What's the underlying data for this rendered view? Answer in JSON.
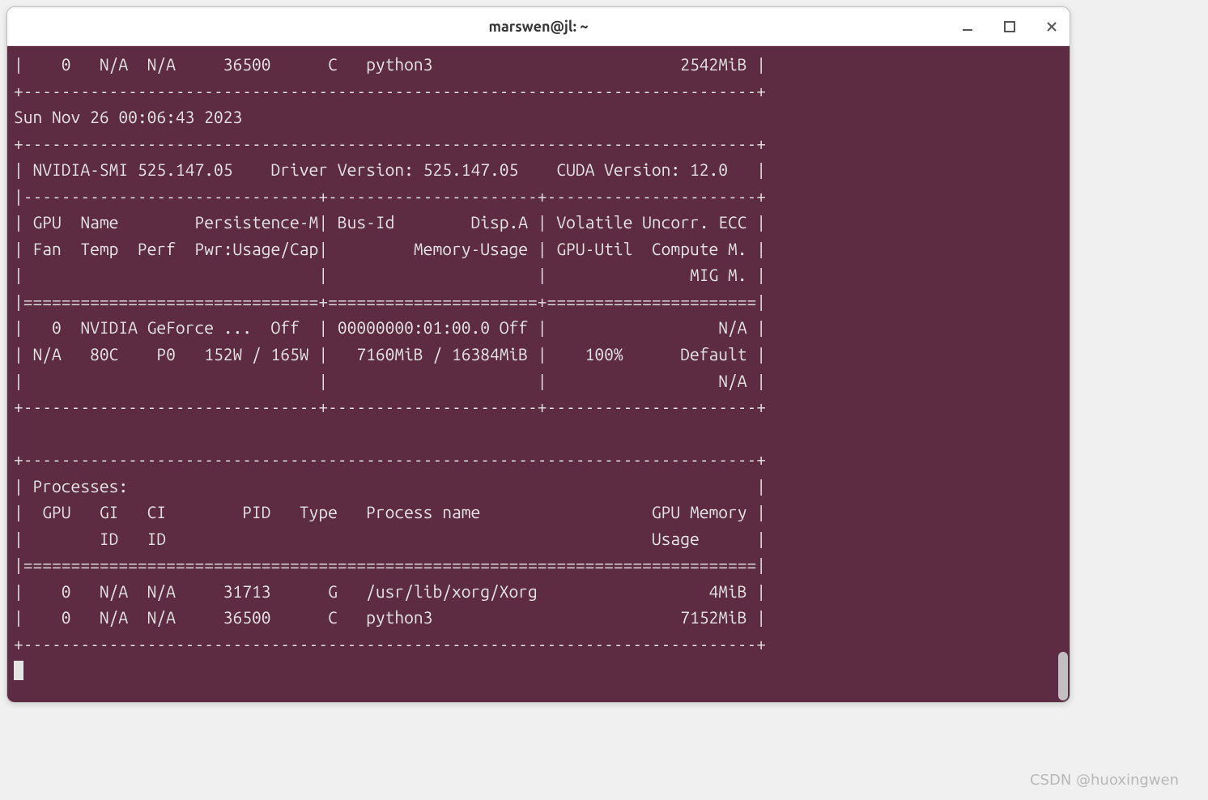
{
  "window": {
    "title": "marswen@jl: ~"
  },
  "watermark": "CSDN @huoxingwen",
  "colors": {
    "terminal_bg": "#5d2b42",
    "terminal_fg": "#e4e4e4"
  },
  "previous_tail": {
    "process": {
      "gpu": "0",
      "gi": "N/A",
      "ci": "N/A",
      "pid": "36500",
      "type": "C",
      "name": "python3",
      "mem": "2542MiB"
    }
  },
  "timestamp": "Sun Nov 26 00:06:43 2023",
  "header": {
    "nvidia_smi": "525.147.05",
    "driver_version": "525.147.05",
    "cuda_version": "12.0"
  },
  "gpu_table": {
    "headers": {
      "c1l1": "GPU  Name        Persistence-M",
      "c1l2": "Fan  Temp  Perf  Pwr:Usage/Cap",
      "c2l1": "Bus-Id        Disp.A",
      "c2l2": "Memory-Usage",
      "c3l1": "Volatile Uncorr. ECC",
      "c3l2": "GPU-Util  Compute M.",
      "c3l3": "MIG M."
    },
    "row": {
      "gpu_id": "0",
      "name": "NVIDIA GeForce ...",
      "persistence_m": "Off",
      "fan": "N/A",
      "temp": "80C",
      "perf": "P0",
      "pwr": "152W / 165W",
      "bus_id": "00000000:01:00.0",
      "disp_a": "Off",
      "memory": "7160MiB / 16384MiB",
      "ecc": "N/A",
      "gpu_util": "100%",
      "compute_m": "Default",
      "mig_m": "N/A"
    }
  },
  "processes": {
    "label": "Processes:",
    "headers": {
      "gpu": "GPU",
      "gi": "GI",
      "ci": "CI",
      "pid": "PID",
      "type": "Type",
      "name": "Process name",
      "mem1": "GPU Memory",
      "id": "ID",
      "mem2": "Usage"
    },
    "rows": [
      {
        "gpu": "0",
        "gi": "N/A",
        "ci": "N/A",
        "pid": "31713",
        "type": "G",
        "name": "/usr/lib/xorg/Xorg",
        "mem": "4MiB"
      },
      {
        "gpu": "0",
        "gi": "N/A",
        "ci": "N/A",
        "pid": "36500",
        "type": "C",
        "name": "python3",
        "mem": "7152MiB"
      }
    ]
  },
  "lines": {
    "l01": "|    0   N/A  N/A     36500      C   python3                          2542MiB |",
    "l02": "+-----------------------------------------------------------------------------+",
    "l03": "Sun Nov 26 00:06:43 2023",
    "l04": "+-----------------------------------------------------------------------------+",
    "l05": "| NVIDIA-SMI 525.147.05    Driver Version: 525.147.05    CUDA Version: 12.0   |",
    "l06": "|-------------------------------+----------------------+----------------------+",
    "l07": "| GPU  Name        Persistence-M| Bus-Id        Disp.A | Volatile Uncorr. ECC |",
    "l08": "| Fan  Temp  Perf  Pwr:Usage/Cap|         Memory-Usage | GPU-Util  Compute M. |",
    "l09": "|                               |                      |               MIG M. |",
    "l10": "|===============================+======================+======================|",
    "l11": "|   0  NVIDIA GeForce ...  Off  | 00000000:01:00.0 Off |                  N/A |",
    "l12": "| N/A   80C    P0   152W / 165W |   7160MiB / 16384MiB |    100%      Default |",
    "l13": "|                               |                      |                  N/A |",
    "l14": "+-------------------------------+----------------------+----------------------+",
    "l15": "                                                                               ",
    "l16": "+-----------------------------------------------------------------------------+",
    "l17": "| Processes:                                                                  |",
    "l18": "|  GPU   GI   CI        PID   Type   Process name                  GPU Memory |",
    "l19": "|        ID   ID                                                   Usage      |",
    "l20": "|=============================================================================|",
    "l21": "|    0   N/A  N/A     31713      G   /usr/lib/xorg/Xorg                  4MiB |",
    "l22": "|    0   N/A  N/A     36500      C   python3                          7152MiB |",
    "l23": "+-----------------------------------------------------------------------------+"
  }
}
